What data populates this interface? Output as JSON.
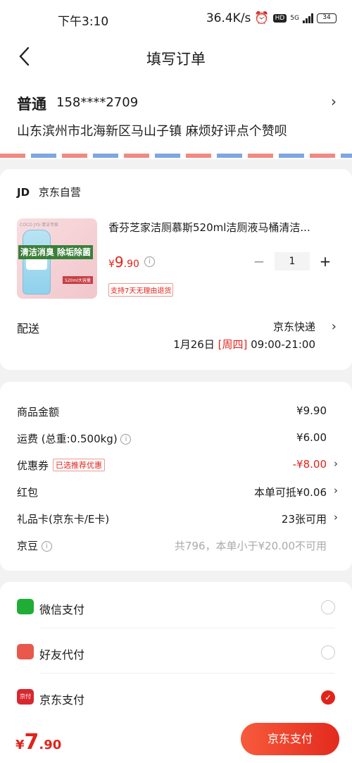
{
  "status_bar": {
    "time": "下午3:10",
    "speed": "36.4K/s",
    "hd": "HD",
    "net": "5G",
    "battery": "34"
  },
  "nav": {
    "title": "填写订单"
  },
  "address": {
    "tag": "普通",
    "phone": "158****2709",
    "detail": "山东滨州市北海新区马山子镇 麻烦好评点个赞呗"
  },
  "shop": {
    "logo": "JD",
    "name": "京东自营",
    "product": {
      "image_brand": "COCO JYS·清洁专家",
      "image_text": "清洁消臭 除垢除菌",
      "image_volume": "520ml大容量",
      "title": "香芬芝家洁厕慕斯520ml洁厕液马桶清洁...",
      "currency": "¥",
      "price_int": "9",
      "price_dec": ".90",
      "qty": "1",
      "minus": "−",
      "plus": "+",
      "return_tag": "支持7天无理由退货"
    },
    "delivery": {
      "label": "配送",
      "company": "京东快递",
      "date": "1月26日",
      "weekday": "[周四]",
      "time": "09:00-21:00"
    }
  },
  "fees": {
    "goods_label": "商品金额",
    "goods_value": "¥9.90",
    "ship_label": "运费 (总重:0.500kg)",
    "ship_value": "¥6.00",
    "coupon_label": "优惠券",
    "coupon_badge": "已选推荐优惠",
    "coupon_value": "-¥8.00",
    "hongbao_label": "红包",
    "hongbao_value": "本单可抵¥0.06",
    "gift_label": "礼品卡(京东卡/E卡)",
    "gift_value": "23张可用",
    "bean_label": "京豆",
    "bean_value": "共796，本单小于¥20.00不可用"
  },
  "payment": {
    "options": [
      {
        "label": "微信支付",
        "icon": "wechat-pay-icon",
        "selected": false
      },
      {
        "label": "好友代付",
        "icon": "friend-pay-icon",
        "selected": false
      },
      {
        "label": "京东支付",
        "icon": "jd-pay-icon",
        "selected": true
      }
    ],
    "jd_icon_text": "京付"
  },
  "bottom": {
    "currency": "¥",
    "total_int": "7",
    "total_dec": ".90",
    "submit": "京东支付"
  },
  "colors": {
    "accent": "#e2231a",
    "wechat": "#1fad36"
  }
}
